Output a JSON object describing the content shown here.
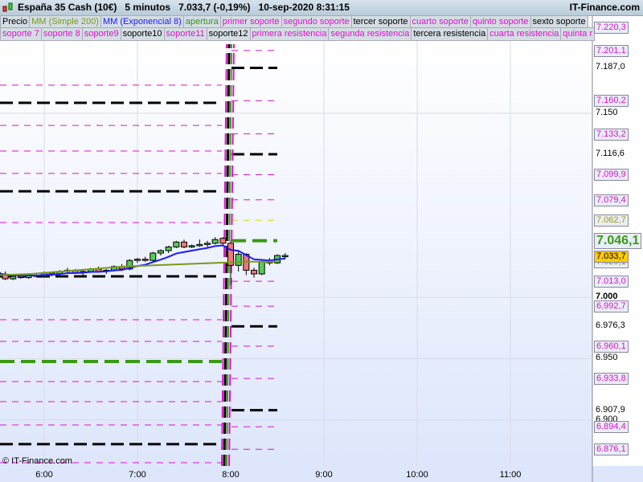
{
  "title": {
    "instrument": "España 35 Cash (10€)",
    "timeframe": "5 minutos",
    "price": "7.033,7 (-0,19%)",
    "datetime": "10-sep-2020 8:31:15",
    "brand": "IT-Finance.com"
  },
  "legend1": [
    {
      "label": "Precio",
      "color": "#000000"
    },
    {
      "label": "MM (Simple 200)",
      "color": "#7a9a1a"
    },
    {
      "label": "MM (Exponencial 8)",
      "color": "#1a1aff"
    },
    {
      "label": "apertura",
      "color": "#2e9a12"
    },
    {
      "label": "primer soporte",
      "color": "#e010d0"
    },
    {
      "label": "segundo soporte",
      "color": "#e010d0"
    },
    {
      "label": "tercer soporte",
      "color": "#000000"
    },
    {
      "label": "cuarto soporte",
      "color": "#e010d0"
    },
    {
      "label": "quinto soporte",
      "color": "#e010d0"
    },
    {
      "label": "sexto soporte",
      "color": "#000000"
    }
  ],
  "legend2": [
    {
      "label": "soporte 7",
      "color": "#e010d0"
    },
    {
      "label": "soporte 8",
      "color": "#e010d0"
    },
    {
      "label": "soporte9",
      "color": "#e010d0"
    },
    {
      "label": "soporte10",
      "color": "#000000"
    },
    {
      "label": "soporte11",
      "color": "#e010d0"
    },
    {
      "label": "soporte12",
      "color": "#000000"
    },
    {
      "label": "primera resistencia",
      "color": "#e010d0"
    },
    {
      "label": "segunda resistencia",
      "color": "#e010d0"
    },
    {
      "label": "tercera resistencia",
      "color": "#000000"
    },
    {
      "label": "cuarta resistencia",
      "color": "#e010d0"
    },
    {
      "label": "quinta r",
      "color": "#e010d0"
    }
  ],
  "axis_ticks": [
    {
      "p": 7150,
      "label": "7.150"
    },
    {
      "p": 7000,
      "label": "7.000"
    },
    {
      "p": 6950,
      "label": "6.950"
    },
    {
      "p": 6900,
      "label": "6.900"
    }
  ],
  "x_ticks": [
    {
      "h": 6,
      "label": "6:00"
    },
    {
      "h": 7,
      "label": "7:00"
    },
    {
      "h": 8,
      "label": "8:00"
    },
    {
      "h": 9,
      "label": "9:00"
    },
    {
      "h": 10,
      "label": "10:00"
    },
    {
      "h": 11,
      "label": "11:00"
    }
  ],
  "levels": [
    {
      "p": 7220.3,
      "label": "7.220,3",
      "kind": "m"
    },
    {
      "p": 7201.1,
      "label": "7.201,1",
      "kind": "m"
    },
    {
      "p": 7187.0,
      "label": "7.187,0",
      "kind": "b"
    },
    {
      "p": 7160.2,
      "label": "7.160,2",
      "kind": "m"
    },
    {
      "p": 7133.2,
      "label": "7.133,2",
      "kind": "m"
    },
    {
      "p": 7116.6,
      "label": "7.116,6",
      "kind": "b"
    },
    {
      "p": 7099.9,
      "label": "7.099,9",
      "kind": "m"
    },
    {
      "p": 7079.4,
      "label": "7.079,4",
      "kind": "m"
    },
    {
      "p": 7062.7,
      "label": "7.062,7",
      "kind": "y"
    },
    {
      "p": 7046.1,
      "label": "7.046,1",
      "kind": "g"
    },
    {
      "p": 7013.0,
      "label": "7.013,0",
      "kind": "m"
    },
    {
      "p": 6992.7,
      "label": "6.992,7",
      "kind": "m"
    },
    {
      "p": 6976.3,
      "label": "6.976,3",
      "kind": "b"
    },
    {
      "p": 6960.1,
      "label": "6.960,1",
      "kind": "m"
    },
    {
      "p": 6933.8,
      "label": "6.933,8",
      "kind": "m"
    },
    {
      "p": 6907.9,
      "label": "6.907,9",
      "kind": "b"
    },
    {
      "p": 6894.4,
      "label": "6.894,4",
      "kind": "m"
    },
    {
      "p": 6876.1,
      "label": "6.876,1",
      "kind": "m"
    }
  ],
  "prev_levels": [
    {
      "p": 7172.9,
      "kind": "m"
    },
    {
      "p": 7158.5,
      "kind": "b"
    },
    {
      "p": 7140.1,
      "kind": "m"
    },
    {
      "p": 7119.2,
      "kind": "m"
    },
    {
      "p": 7100.9,
      "kind": "m"
    },
    {
      "p": 7086.4,
      "kind": "b"
    },
    {
      "p": 7060.9,
      "kind": "m"
    },
    {
      "p": 7017.0,
      "kind": "b"
    },
    {
      "p": 6981.7,
      "kind": "m"
    },
    {
      "p": 6964.0,
      "kind": "m"
    },
    {
      "p": 6947.6,
      "kind": "g"
    },
    {
      "p": 6931.2,
      "kind": "m"
    },
    {
      "p": 6914.9,
      "kind": "m"
    },
    {
      "p": 6895.9,
      "kind": "m"
    },
    {
      "p": 6880.2,
      "kind": "b"
    },
    {
      "p": 6865.1,
      "kind": "m"
    }
  ],
  "last_price": {
    "p": 7033.7,
    "label": "7.033,7"
  },
  "sma_value": {
    "p": 7029.1,
    "label": "7.029,1"
  },
  "candles": [
    [
      7019,
      7022,
      7016,
      7020
    ],
    [
      7020,
      7022,
      7017,
      7018
    ],
    [
      7018,
      7021,
      7014,
      7015
    ],
    [
      7015,
      7018,
      7014,
      7017
    ],
    [
      7017,
      7019,
      7015,
      7016
    ],
    [
      7016,
      7019,
      7015,
      7018
    ],
    [
      7018,
      7020,
      7016,
      7017
    ],
    [
      7017,
      7021,
      7016,
      7020
    ],
    [
      7020,
      7021,
      7017,
      7019
    ],
    [
      7019,
      7022,
      7018,
      7021
    ],
    [
      7021,
      7024,
      7020,
      7022
    ],
    [
      7022,
      7023,
      7019,
      7020
    ],
    [
      7020,
      7022,
      7018,
      7021
    ],
    [
      7021,
      7024,
      7020,
      7023
    ],
    [
      7023,
      7025,
      7020,
      7021
    ],
    [
      7021,
      7023,
      7019,
      7022
    ],
    [
      7022,
      7026,
      7021,
      7025
    ],
    [
      7025,
      7027,
      7022,
      7023
    ],
    [
      7023,
      7031,
      7022,
      7030
    ],
    [
      7030,
      7032,
      7028,
      7031
    ],
    [
      7031,
      7033,
      7029,
      7030
    ],
    [
      7030,
      7037,
      7029,
      7036
    ],
    [
      7036,
      7039,
      7034,
      7038
    ],
    [
      7038,
      7042,
      7036,
      7041
    ],
    [
      7041,
      7046,
      7040,
      7045
    ],
    [
      7045,
      7047,
      7040,
      7041
    ],
    [
      7041,
      7043,
      7040,
      7042
    ],
    [
      7042,
      7047,
      7041,
      7043
    ],
    [
      7043,
      7046,
      7041,
      7044
    ],
    [
      7044,
      7049,
      7043,
      7047
    ],
    [
      7048,
      7049,
      7042,
      7044
    ],
    [
      7044,
      7046,
      7010,
      7026
    ],
    [
      7026,
      7038,
      7021,
      7035
    ],
    [
      7035,
      7036,
      7018,
      7022
    ],
    [
      7022,
      7024,
      7016,
      7019
    ],
    [
      7019,
      7030,
      7018,
      7029
    ],
    [
      7029,
      7032,
      7026,
      7028
    ],
    [
      7028,
      7035,
      7027,
      7034
    ],
    [
      7033,
      7036,
      7031,
      7034
    ]
  ],
  "sma": [
    7018,
    7019,
    7021,
    7023,
    7025,
    7026,
    7027,
    7028,
    7029,
    7029
  ]
}
